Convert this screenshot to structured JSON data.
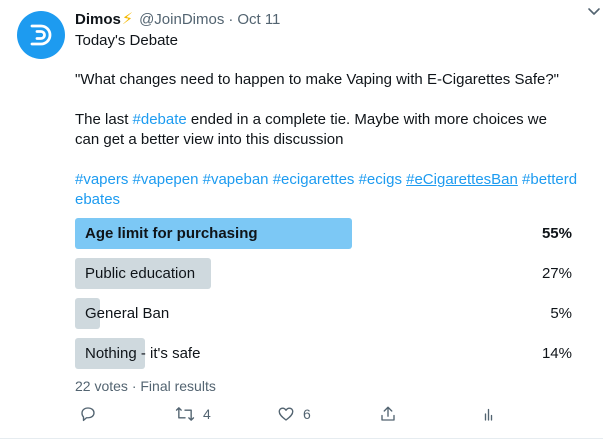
{
  "tweet": {
    "author_name": "Dimos",
    "author_emoji": "⚡",
    "handle": "@JoinDimos",
    "separator": "·",
    "date": "Oct 11",
    "subtitle": "Today's Debate",
    "question": "\"What changes need to happen to make Vaping with E-Cigarettes Safe?\"",
    "para_before": "The last ",
    "para_link": "#debate",
    "para_after": " ended in a complete tie. Maybe with more choices we can get a better view into this discussion",
    "hashtags": [
      "#vapers",
      "#vapepen",
      "#vapeban",
      "#ecigarettes",
      "#ecigs"
    ],
    "hashtag_underlined": "#eCigarettesBan",
    "hashtag_last": "#betterdebates"
  },
  "poll": {
    "options": [
      {
        "label": "Age limit for purchasing",
        "percent_text": "55%",
        "percent": 55,
        "winner": true
      },
      {
        "label": "Public education",
        "percent_text": "27%",
        "percent": 27,
        "winner": false
      },
      {
        "label": "General Ban",
        "percent_text": "5%",
        "percent": 5,
        "winner": false
      },
      {
        "label": "Nothing - it's safe",
        "percent_text": "14%",
        "percent": 14,
        "winner": false
      }
    ],
    "meta": "22 votes · Final results"
  },
  "actions": {
    "reply_icon": "reply-icon",
    "retweet_icon": "retweet-icon",
    "retweet_count": "4",
    "like_icon": "like-icon",
    "like_count": "6",
    "share_icon": "share-icon",
    "analytics_icon": "analytics-icon"
  },
  "colors": {
    "accent": "#1d9bf0",
    "winner_bar": "#7cc8f5",
    "bar": "#cfd9de",
    "muted": "#536471"
  }
}
